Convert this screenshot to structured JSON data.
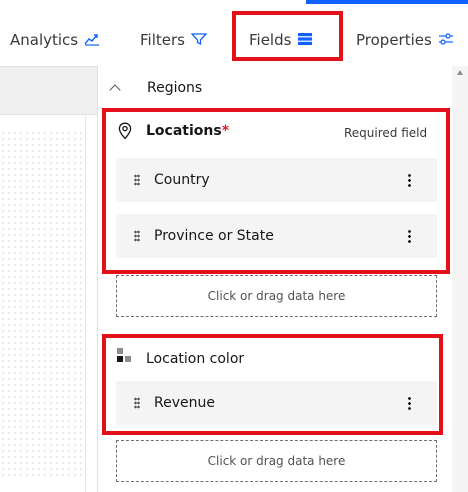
{
  "tabs": {
    "analytics": "Analytics",
    "filters": "Filters",
    "fields": "Fields",
    "properties": "Properties"
  },
  "section": {
    "label": "Regions"
  },
  "locations": {
    "title": "Locations",
    "required_marker": "*",
    "required_note": "Required field",
    "items": [
      "Country",
      "Province or State"
    ],
    "drop_hint": "Click or drag data here"
  },
  "location_color": {
    "title": "Location color",
    "items": [
      "Revenue"
    ],
    "drop_hint": "Click or drag data here"
  },
  "colors": {
    "accent": "#0f62fe",
    "highlight": "#e3101b",
    "required": "#da1e28",
    "row_bg": "#f4f4f4"
  },
  "icons": {
    "analytics": "line-chart-icon",
    "filters": "filter-icon",
    "fields": "fields-icon",
    "properties": "sliders-icon",
    "section": "chevron-up-icon",
    "locations": "location-pin-icon",
    "location_color": "color-swatch-icon",
    "drag": "drag-handle-icon",
    "overflow": "overflow-menu-icon"
  }
}
